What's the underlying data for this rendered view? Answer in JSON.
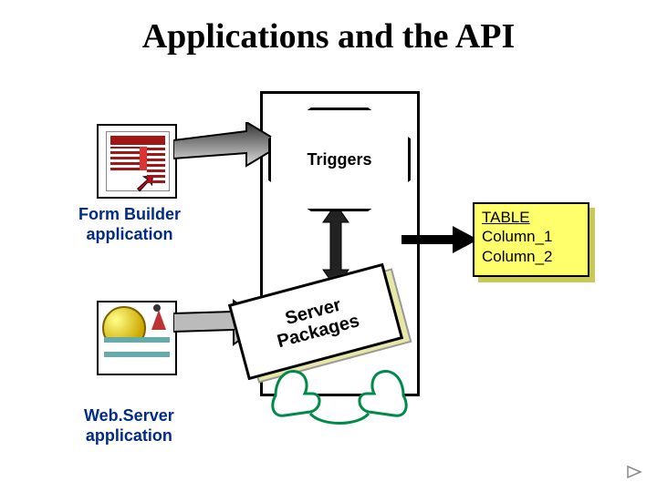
{
  "title": "Applications and the API",
  "formBuilder": {
    "caption_l1": "Form Builder",
    "caption_l2": "application"
  },
  "webServer": {
    "caption_l1": "Web.Server",
    "caption_l2": "application"
  },
  "triggers": {
    "label": "Triggers"
  },
  "serverPackages": {
    "line1": "Server",
    "line2": "Packages"
  },
  "table": {
    "header": "TABLE",
    "col1": "Column_1",
    "col2": "Column_2"
  },
  "icons": {
    "formBuilder": "form-builder-icon",
    "webServer": "web-server-icon",
    "hands": "hands-icon",
    "nextTriangle": "next-slide-icon"
  }
}
